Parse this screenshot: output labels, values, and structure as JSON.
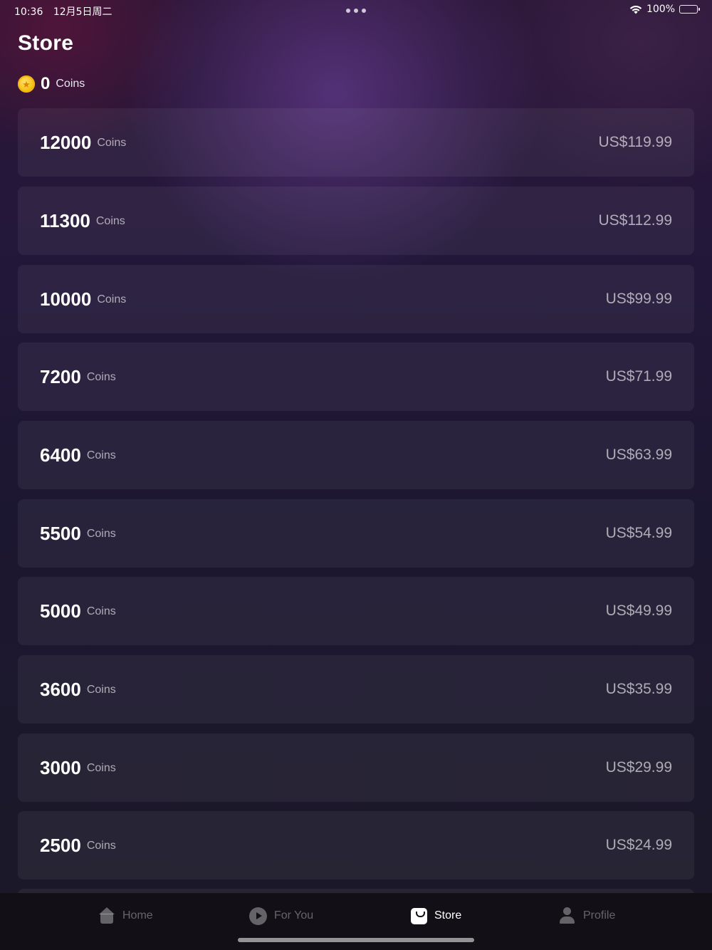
{
  "status_bar": {
    "time": "10:36",
    "date": "12月5日周二",
    "battery": "100%",
    "icons": [
      "wifi-icon",
      "battery-icon",
      "multitask-dots-icon"
    ]
  },
  "page": {
    "title": "Store"
  },
  "balance": {
    "value": "0",
    "unit": "Coins",
    "icon": "coin-icon"
  },
  "packs": [
    {
      "amount": "12000",
      "unit": "Coins",
      "price": "US$119.99"
    },
    {
      "amount": "11300",
      "unit": "Coins",
      "price": "US$112.99"
    },
    {
      "amount": "10000",
      "unit": "Coins",
      "price": "US$99.99"
    },
    {
      "amount": "7200",
      "unit": "Coins",
      "price": "US$71.99"
    },
    {
      "amount": "6400",
      "unit": "Coins",
      "price": "US$63.99"
    },
    {
      "amount": "5500",
      "unit": "Coins",
      "price": "US$54.99"
    },
    {
      "amount": "5000",
      "unit": "Coins",
      "price": "US$49.99"
    },
    {
      "amount": "3600",
      "unit": "Coins",
      "price": "US$35.99"
    },
    {
      "amount": "3000",
      "unit": "Coins",
      "price": "US$29.99"
    },
    {
      "amount": "2500",
      "unit": "Coins",
      "price": "US$24.99"
    }
  ],
  "tab_bar": {
    "active": "store",
    "tabs": [
      {
        "id": "home",
        "label": "Home",
        "icon": "home-icon"
      },
      {
        "id": "for-you",
        "label": "For You",
        "icon": "play-icon"
      },
      {
        "id": "store",
        "label": "Store",
        "icon": "store-bag-icon"
      },
      {
        "id": "profile",
        "label": "Profile",
        "icon": "person-icon"
      }
    ]
  },
  "colors": {
    "accent_text": "#ffffff",
    "muted_text": "#a8a3b3",
    "coin_gold": "#f7c31a",
    "tab_bar_bg": "#121016"
  }
}
